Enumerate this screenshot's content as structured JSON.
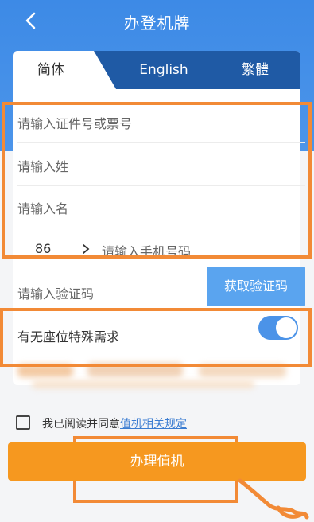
{
  "header": {
    "title": "办登机牌",
    "back_icon": "chevron-left-icon"
  },
  "tabs": [
    {
      "label": "简体",
      "active": true
    },
    {
      "label": "English",
      "active": false
    },
    {
      "label": "繁體",
      "active": false
    }
  ],
  "form": {
    "id_placeholder": "请输入证件号或票号",
    "surname_placeholder": "请输入姓",
    "given_name_placeholder": "请输入名",
    "country_code": "86",
    "phone_placeholder": "请输入手机号码",
    "verify_placeholder": "请输入验证码",
    "get_code_label": "获取验证码",
    "special_seat_label": "有无座位特殊需求",
    "special_seat_on": true
  },
  "agreement": {
    "text": "我已阅读并同意",
    "link_text": "值机相关规定",
    "checked": false
  },
  "submit_label": "办理值机",
  "colors": {
    "header_blue": "#3d8ae6",
    "tab_bar": "#1f5aa5",
    "highlight_orange": "#f28a36",
    "submit_orange": "#f6981f",
    "link_blue": "#3a7cd1"
  }
}
